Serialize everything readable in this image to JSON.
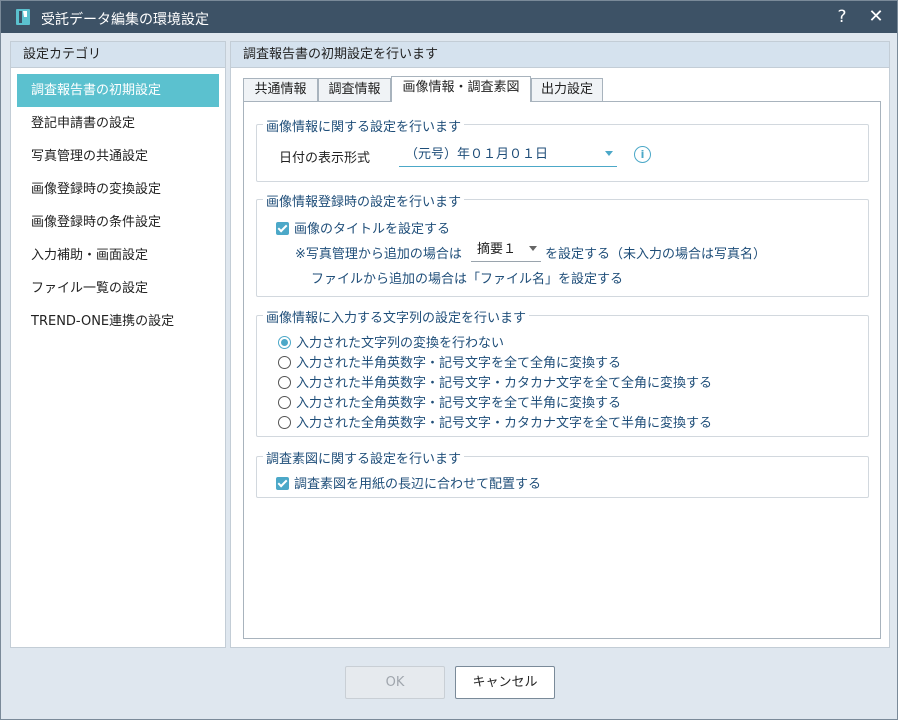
{
  "window": {
    "title": "受託データ編集の環境設定",
    "help_label": "?",
    "close_label": "✕"
  },
  "sidebar": {
    "header": "設定カテゴリ",
    "items": [
      {
        "label": "調査報告書の初期設定"
      },
      {
        "label": "登記申請書の設定"
      },
      {
        "label": "写真管理の共通設定"
      },
      {
        "label": "画像登録時の変換設定"
      },
      {
        "label": "画像登録時の条件設定"
      },
      {
        "label": "入力補助・画面設定"
      },
      {
        "label": "ファイル一覧の設定"
      },
      {
        "label": "TREND-ONE連携の設定"
      }
    ],
    "selected_index": 0
  },
  "main": {
    "header": "調査報告書の初期設定を行います",
    "tabs": [
      {
        "label": "共通情報"
      },
      {
        "label": "調査情報"
      },
      {
        "label": "画像情報・調査素図"
      },
      {
        "label": "出力設定"
      }
    ],
    "active_tab": 2,
    "groups": {
      "image_info": {
        "title": "画像情報に関する設定を行います",
        "date_format_label": "日付の表示形式",
        "date_format_value": "（元号）年０１月０１日"
      },
      "image_register": {
        "title": "画像情報登録時の設定を行います",
        "set_title_label": "画像のタイトルを設定する",
        "set_title_checked": true,
        "photo_prefix": "※写真管理から追加の場合は",
        "photo_select_value": "摘要１",
        "photo_suffix": "を設定する（未入力の場合は写真名）",
        "file_note": "ファイルから追加の場合は「ファイル名」を設定する"
      },
      "text_convert": {
        "title": "画像情報に入力する文字列の設定を行います",
        "options": [
          {
            "label": "入力された文字列の変換を行わない"
          },
          {
            "label": "入力された半角英数字・記号文字を全て全角に変換する"
          },
          {
            "label": "入力された半角英数字・記号文字・カタカナ文字を全て全角に変換する"
          },
          {
            "label": "入力された全角英数字・記号文字を全て半角に変換する"
          },
          {
            "label": "入力された全角英数字・記号文字・カタカナ文字を全て半角に変換する"
          }
        ],
        "selected_index": 0
      },
      "survey_map": {
        "title": "調査素図に関する設定を行います",
        "fit_label": "調査素図を用紙の長辺に合わせて配置する",
        "fit_checked": true
      }
    }
  },
  "footer": {
    "ok_label": "OK",
    "cancel_label": "キャンセル"
  },
  "colors": {
    "titlebar": "#3d5266",
    "accent": "#5bc1cf",
    "check": "#4ca8c8",
    "group_text": "#1f4e79"
  }
}
